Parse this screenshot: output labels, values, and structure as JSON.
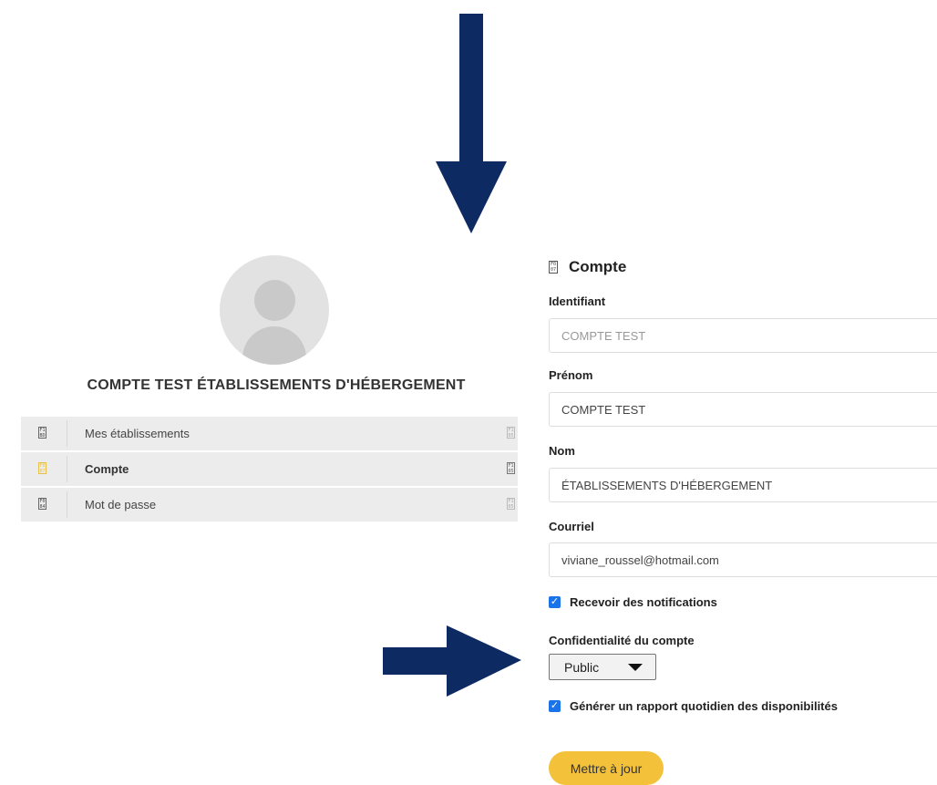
{
  "profile": {
    "name": "COMPTE TEST ÉTABLISSEMENTS D'HÉBERGEMENT"
  },
  "menu": {
    "items": [
      {
        "label": "Mes établissements",
        "icon": "building-icon",
        "active": false
      },
      {
        "label": "Compte",
        "icon": "account-icon",
        "active": true
      },
      {
        "label": "Mot de passe",
        "icon": "key-icon",
        "active": false
      }
    ]
  },
  "form": {
    "title": "Compte",
    "title_icon": "account-icon",
    "identifiant": {
      "label": "Identifiant",
      "value": "COMPTE TEST"
    },
    "prenom": {
      "label": "Prénom",
      "value": "COMPTE TEST"
    },
    "nom": {
      "label": "Nom",
      "value": "ÉTABLISSEMENTS D'HÉBERGEMENT"
    },
    "courriel": {
      "label": "Courriel",
      "value": "viviane_roussel@hotmail.com"
    },
    "notifications": {
      "label": "Recevoir des notifications",
      "checked": true
    },
    "confidentialite": {
      "label": "Confidentialité du compte",
      "value": "Public"
    },
    "rapport": {
      "label": "Générer un rapport quotidien des disponibilités",
      "checked": true
    },
    "submit_label": "Mettre à jour"
  },
  "colors": {
    "arrow": "#0d2a63",
    "accent_button": "#f3c13a",
    "checkbox": "#1a73e8",
    "menu_bg": "#ececec"
  }
}
